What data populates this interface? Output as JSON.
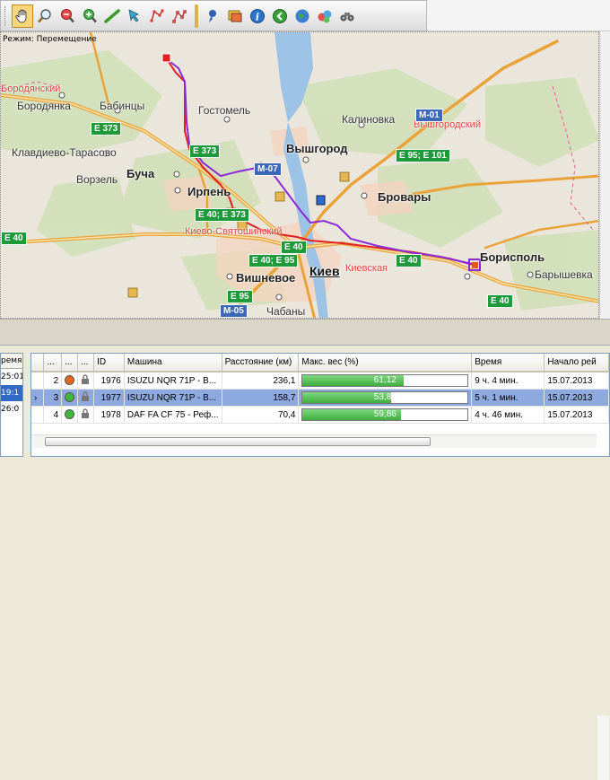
{
  "toolbar": {
    "buttons": [
      {
        "name": "pan-hand-icon",
        "active": true
      },
      {
        "name": "zoom-select-icon"
      },
      {
        "name": "zoom-out-icon"
      },
      {
        "name": "zoom-in-icon"
      },
      {
        "name": "ruler-icon"
      },
      {
        "name": "select-arrow-icon"
      },
      {
        "name": "route-nodes-icon"
      },
      {
        "name": "route-nodes-red-icon"
      },
      {
        "name": "pin-icon"
      },
      {
        "name": "layers-icon"
      },
      {
        "name": "info-icon"
      },
      {
        "name": "back-icon"
      },
      {
        "name": "globe-icon"
      },
      {
        "name": "balls-icon"
      },
      {
        "name": "binoculars-icon"
      }
    ]
  },
  "map": {
    "mode_label": "Режим: Перемещение",
    "cities": {
      "borodyanka": "Бородянка",
      "babintsy": "Бабинцы",
      "gostomel": "Гостомель",
      "kalinovka": "Калиновка",
      "klavdievo": "Клавдиево-Тарасово",
      "vyshgorod": "Вышгород",
      "vorzel": "Ворзель",
      "bucha": "Буча",
      "irpen": "Ирпень",
      "brovary": "Бровары",
      "kiev": "Киев",
      "borispol": "Борисполь",
      "baryshevka": "Барышевка",
      "vishnevoe": "Вишневое",
      "chabany": "Чабаны",
      "kiev_oblast": "Киево-Святошинский",
      "kievskaya": "Киевская",
      "borodyansky": "Бородянский",
      "vyshgorodsky": "Вышгородский"
    },
    "roads": {
      "m01": "M-01",
      "e373": "E 373",
      "e373b": "E 373",
      "m07": "M-07",
      "e95e101": "E 95; E 101",
      "e40e373": "E 40; E 373",
      "e40w": "E 40",
      "e40e95": "E 40; E 95",
      "e40c": "E 40",
      "e40e": "E 40",
      "e95": "E 95",
      "m05": "M-05",
      "e40f": "E 40"
    },
    "colors": {
      "route_red": "#e02020",
      "route_purple": "#8a2bd6",
      "road": "#e9a33a",
      "water": "#9cc2e6",
      "forest": "#c9ddb0"
    }
  },
  "left_pane": {
    "header": "ремя п",
    "rows": [
      "25:01",
      "19:1",
      "26:0"
    ]
  },
  "grid": {
    "columns": [
      "...",
      "...",
      "...",
      "ID",
      "Машина",
      "Расстояние (км)",
      "Макс. вес (%)",
      "Время",
      "Начало рей"
    ],
    "rows": [
      {
        "no": "2",
        "status_color": "#e8661c",
        "id": "1976",
        "vehicle": "ISUZU NQR 71P - B...",
        "distance": "236,1",
        "weight_pct": 61.12,
        "weight_label": "61,12",
        "time": "9 ч. 4 мин.",
        "start": "15.07.2013",
        "selected": false
      },
      {
        "no": "3",
        "status_color": "#3cb83c",
        "id": "1977",
        "vehicle": "ISUZU NQR 71P - B...",
        "distance": "158,7",
        "weight_pct": 53.85,
        "weight_label": "53,85",
        "time": "5 ч. 1 мин.",
        "start": "15.07.2013",
        "selected": true
      },
      {
        "no": "4",
        "status_color": "#3cb83c",
        "id": "1978",
        "vehicle": "DAF FA CF 75 - Реф...",
        "distance": "70,4",
        "weight_pct": 59.86,
        "weight_label": "59,86",
        "time": "4 ч. 46 мин.",
        "start": "15.07.2013",
        "selected": false
      }
    ]
  }
}
